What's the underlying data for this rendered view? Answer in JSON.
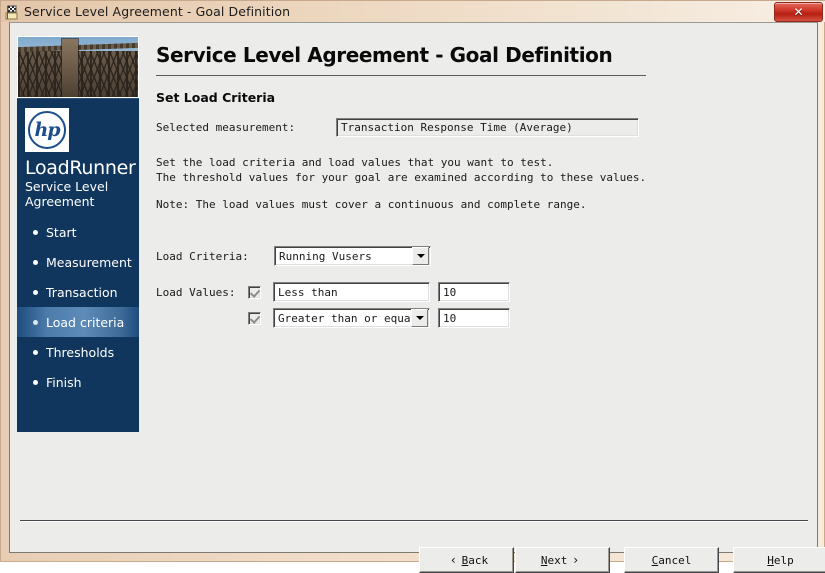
{
  "window": {
    "title": "Service Level Agreement - Goal Definition",
    "icon": "wizard-flag-icon",
    "close_label": "✕"
  },
  "sidebar": {
    "photo_alt": "roller-coaster-photo",
    "logo": "hp",
    "brand_title": "LoadRunner",
    "brand_subtitle": "Service Level\nAgreement",
    "items": [
      {
        "label": "Start",
        "selected": false
      },
      {
        "label": "Measurement",
        "selected": false
      },
      {
        "label": "Transaction",
        "selected": false
      },
      {
        "label": "Load criteria",
        "selected": true
      },
      {
        "label": "Thresholds",
        "selected": false
      },
      {
        "label": "Finish",
        "selected": false
      }
    ]
  },
  "main": {
    "page_title": "Service Level Agreement - Goal Definition",
    "section_title": "Set Load Criteria",
    "measurement_label": "Selected measurement:",
    "measurement_value": "Transaction Response Time (Average)",
    "description_line1": "Set the load criteria and load values that you want to test.",
    "description_line2": "The threshold values for your goal are examined according to these values.",
    "note": "Note: The load values must cover a continuous and complete range.",
    "load_criteria_label": "Load Criteria:",
    "load_criteria_value": "Running Vusers",
    "load_values_label": "Load Values:",
    "rows": [
      {
        "checked": true,
        "operator": "Less than",
        "has_dropdown": false,
        "value": "10"
      },
      {
        "checked": true,
        "operator": "Greater than or equal t",
        "has_dropdown": true,
        "value": "10"
      }
    ]
  },
  "footer": {
    "back": {
      "mnemonic": "B",
      "before": "",
      "after": "ack",
      "chevron": "‹",
      "chevron_side": "left"
    },
    "next": {
      "mnemonic": "N",
      "before": "",
      "after": "ext",
      "chevron": "›",
      "chevron_side": "right"
    },
    "cancel": {
      "mnemonic": "C",
      "before": "",
      "after": "ancel"
    },
    "help": {
      "mnemonic": "H",
      "before": "",
      "after": "elp"
    }
  },
  "colors": {
    "brand_blue": "#10365e",
    "title_bar": "#eed9c2",
    "client_bg": "#ececeb",
    "close_red": "#cf3728"
  }
}
